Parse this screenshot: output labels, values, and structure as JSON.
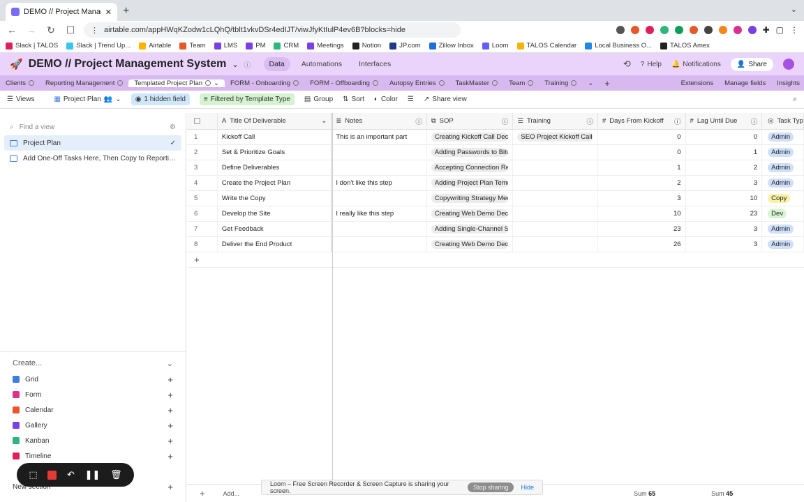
{
  "browser": {
    "tab_title": "DEMO // Project Management S",
    "url": "airtable.com/appHWqKZodw1cLQhQ/tblt1vkvDSr4edIJT/viwJfyKtIulP4ev6B?blocks=hide",
    "bookmarks": [
      "Slack | TALOS",
      "Slack | Trend Up...",
      "Airtable",
      "Team",
      "LMS",
      "PM",
      "CRM",
      "Meetings",
      "Notion",
      "JP.com",
      "Zillow Inbox",
      "Loom",
      "TALOS Calendar",
      "Local Business O...",
      "TALOS Amex"
    ],
    "bookmark_colors": [
      "#e01e5a",
      "#36c5f0",
      "#fcb400",
      "#e8572a",
      "#7b3fe4",
      "#7b3fe4",
      "#2eb67d",
      "#7b3fe4",
      "#222222",
      "#1e3a8a",
      "#1e6fd9",
      "#625df5",
      "#f4b400",
      "#1e88e5",
      "#222222"
    ]
  },
  "base": {
    "title": "DEMO // Project Management System",
    "tabs": [
      "Data",
      "Automations",
      "Interfaces"
    ],
    "help": "Help",
    "notifications": "Notifications",
    "share": "Share"
  },
  "tables": {
    "items": [
      "Clients",
      "Reporting Management",
      "Templated Project Plan",
      "FORM - Onboarding",
      "FORM - Offboarding",
      "Autopsy Entries",
      "TaskMaster",
      "Team",
      "Training"
    ],
    "right": [
      "Extensions",
      "Manage fields",
      "Insights"
    ]
  },
  "toolbar": {
    "views": "Views",
    "view_name": "Project Plan",
    "hidden": "1 hidden field",
    "filter": "Filtered by Template Type",
    "group": "Group",
    "sort": "Sort",
    "color": "Color",
    "share_view": "Share view"
  },
  "sidebar": {
    "find_placeholder": "Find a view",
    "views": [
      "Project Plan",
      "Add One-Off Tasks Here, Then Copy to Reporting ..."
    ],
    "create_label": "Create...",
    "create_items": [
      {
        "label": "Grid",
        "color": "#3b7de0"
      },
      {
        "label": "Form",
        "color": "#d9318f"
      },
      {
        "label": "Calendar",
        "color": "#e8572a"
      },
      {
        "label": "Gallery",
        "color": "#7b3fe4"
      },
      {
        "label": "Kanban",
        "color": "#2eb67d"
      },
      {
        "label": "Timeline",
        "color": "#e01e5a"
      }
    ],
    "new_section": "New section"
  },
  "grid": {
    "columns": {
      "title": "Title Of Deliverable",
      "notes": "Notes",
      "sop": "SOP",
      "training": "Training",
      "days": "Days From Kickoff",
      "lag": "Lag Until Due",
      "type": "Task Type"
    },
    "rows": [
      {
        "num": "1",
        "title": "Kickoff Call",
        "notes": "This is an important part",
        "sop": "Creating Kickoff Call Decks",
        "training": "SEO Project Kickoff Call",
        "days": "0",
        "lag": "0",
        "type": "Admin"
      },
      {
        "num": "2",
        "title": "Set & Prioritize Goals",
        "notes": "",
        "sop": "Adding Passwords to Bitwarden",
        "training": "",
        "days": "0",
        "lag": "1",
        "type": "Admin"
      },
      {
        "num": "3",
        "title": "Define Deliverables",
        "notes": "",
        "sop": "Accepting Connection Requests",
        "training": "",
        "days": "1",
        "lag": "2",
        "type": "Admin"
      },
      {
        "num": "4",
        "title": "Create the Project Plan",
        "notes": "I don't like this step",
        "sop": "Adding Project Plan Templates",
        "training": "",
        "days": "2",
        "lag": "3",
        "type": "Admin"
      },
      {
        "num": "5",
        "title": "Write the Copy",
        "notes": "",
        "sop": "Copywriting Strategy Meeting",
        "training": "",
        "days": "3",
        "lag": "10",
        "type": "Copy"
      },
      {
        "num": "6",
        "title": "Develop the Site",
        "notes": "I really like this step",
        "sop": "Creating Web Demo Decks",
        "training": "",
        "days": "10",
        "lag": "23",
        "type": "Dev"
      },
      {
        "num": "7",
        "title": "Get Feedback",
        "notes": "",
        "sop": "Adding Single-Channel Slack",
        "training": "",
        "days": "23",
        "lag": "3",
        "type": "Admin"
      },
      {
        "num": "8",
        "title": "Deliver the End Product",
        "notes": "",
        "sop": "Creating Web Demo Decks",
        "training": "",
        "days": "26",
        "lag": "3",
        "type": "Admin"
      }
    ],
    "type_colors": {
      "Admin": "#cfe0fb",
      "Copy": "#fbf1a6",
      "Dev": "#d7f5d0"
    },
    "footer": {
      "add": "Add...",
      "sum_label": "Sum",
      "sum_days": "65",
      "sum_lag": "45"
    }
  },
  "loom": {
    "banner": "Loom – Free Screen Recorder & Screen Capture is sharing your screen.",
    "stop": "Stop sharing",
    "hide": "Hide"
  }
}
